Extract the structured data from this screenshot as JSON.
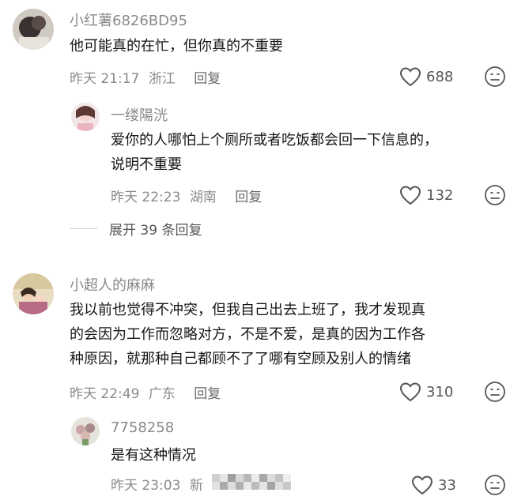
{
  "comments": [
    {
      "username": "小红薯6826BD95",
      "lines": [
        "他可能真的在忙，但你真的不重要"
      ],
      "time": "昨天 21:17",
      "location": "浙江",
      "reply_label": "回复",
      "likes": "688",
      "replies": [
        {
          "username": "一缕陽洸",
          "lines": [
            "爱你的人哪怕上个厕所或者吃饭都会回一下信息的，",
            "说明不重要"
          ],
          "time": "昨天 22:23",
          "location": "湖南",
          "reply_label": "回复",
          "likes": "132"
        }
      ],
      "expand_label": "展开 39 条回复"
    },
    {
      "username": "小超人的麻麻",
      "lines": [
        "我以前也觉得不冲突，但我自己出去上班了，我才发现真",
        "的会因为工作而忽略对方，不是不爱，是真的因为工作各",
        "种原因，就那种自己都顾不了了哪有空顾及别人的情绪"
      ],
      "time": "昨天 22:49",
      "location": "广东",
      "reply_label": "回复",
      "likes": "310",
      "replies": [
        {
          "username": "7758258",
          "lines": [
            "是有这种情况"
          ],
          "time": "昨天 23:03",
          "location": "新",
          "reply_label": "",
          "likes": "33"
        }
      ]
    }
  ],
  "icons": {
    "like": "heart-outline-icon",
    "dislike": "frown-face-icon"
  },
  "colors": {
    "username": "#8a8a8a",
    "text": "#161616",
    "meta": "#8a8a8a"
  }
}
